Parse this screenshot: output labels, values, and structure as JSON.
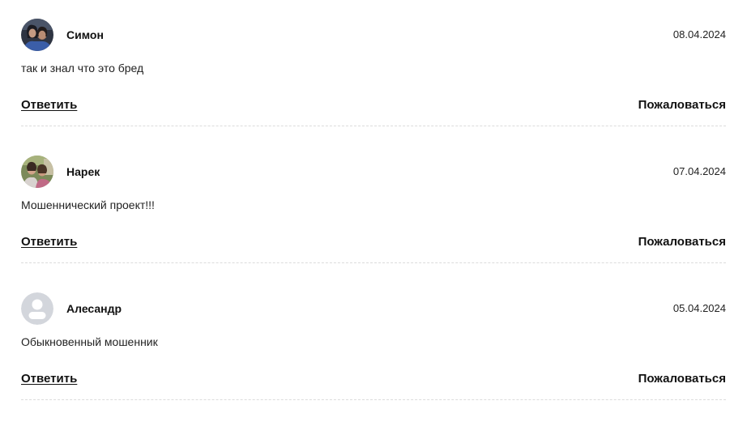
{
  "comments": [
    {
      "author": "Симон",
      "date": "08.04.2024",
      "text": "так и знал что это бред",
      "reply_label": "Ответить",
      "report_label": "Пожаловаться",
      "avatar": "user-photo"
    },
    {
      "author": "Нарек",
      "date": "07.04.2024",
      "text": "Мошеннический проект!!!",
      "reply_label": "Ответить",
      "report_label": "Пожаловаться",
      "avatar": "user-photo"
    },
    {
      "author": "Алесандр",
      "date": "05.04.2024",
      "text": "Обыкновенный мошенник",
      "reply_label": "Ответить",
      "report_label": "Пожаловаться",
      "avatar": "default-user-icon"
    }
  ],
  "colors": {
    "text": "#1a1a1a",
    "divider": "#dcdcdc",
    "default_avatar_bg": "#d3d6dc",
    "default_avatar_fg": "#ffffff"
  }
}
